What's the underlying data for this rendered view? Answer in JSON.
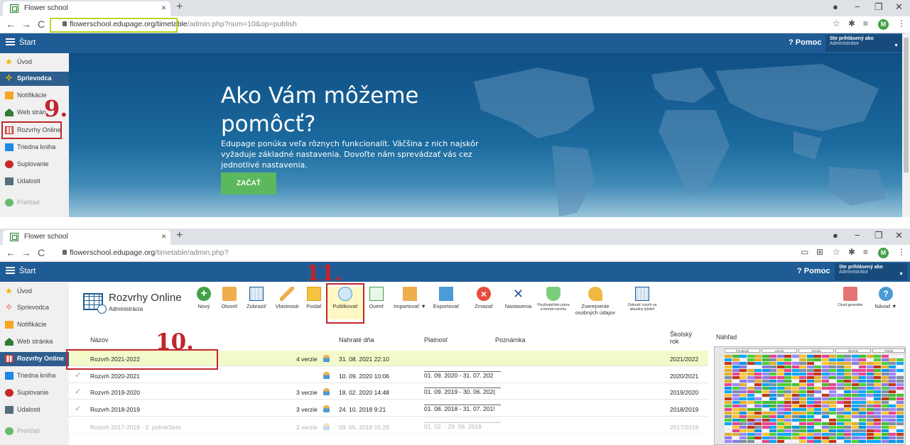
{
  "browser": {
    "tab_title": "Flower school",
    "url_top_host": "flowerschool.edupage.org/timetable",
    "url_top_path": "/admin.php?num=10&op=publish",
    "url_bottom_host": "flowerschool.edupage.org",
    "url_bottom_path": "/timetable/admin.php?",
    "profile_initial": "M"
  },
  "app": {
    "start_label": "Štart",
    "help_label": "Pomoc",
    "user_line1": "Ste prihlásený ako",
    "user_line2": "Administrátor"
  },
  "sidebar_top": [
    {
      "label": "Úvod",
      "icon": "star-icon"
    },
    {
      "label": "Sprievodca",
      "icon": "magic-wand-icon"
    },
    {
      "label": "Notifikácie",
      "icon": "mail-icon"
    },
    {
      "label": "Web strán",
      "icon": "home-icon"
    },
    {
      "label": "Rozvrhy Online",
      "icon": "timetable-icon"
    },
    {
      "label": "Triedna kniha",
      "icon": "book-icon"
    },
    {
      "label": "Suplovanie",
      "icon": "substitution-icon"
    },
    {
      "label": "Udalosti",
      "icon": "calendar-icon"
    },
    {
      "label": "Prehľad",
      "icon": "overview-icon"
    }
  ],
  "sidebar_bottom": [
    {
      "label": "Úvod",
      "icon": "star-icon"
    },
    {
      "label": "Sprievodca",
      "icon": "magic-wand-icon"
    },
    {
      "label": "Notifikácie",
      "icon": "mail-icon"
    },
    {
      "label": "Web stránka",
      "icon": "home-icon"
    },
    {
      "label": "Rozvrhy Online",
      "icon": "timetable-icon"
    },
    {
      "label": "Triedna kniha",
      "icon": "book-icon"
    },
    {
      "label": "Suplovanie",
      "icon": "substitution-icon"
    },
    {
      "label": "Udalosti",
      "icon": "calendar-icon"
    },
    {
      "label": "Prehľad",
      "icon": "overview-icon"
    }
  ],
  "hero": {
    "title": "Ako Vám môžeme pomôcť?",
    "text": "Edupage ponúka veľa rôznych funkcionalít. Väčšina z nich najskôr vyžaduje základné nastavenia. Dovoľte nám sprevádzať vás cez jednotlivé nastavenia.",
    "button": "ZAČAŤ"
  },
  "module": {
    "title": "Rozvrhy Online",
    "subtitle": "Administrácia"
  },
  "toolbar": [
    {
      "label": "Nový",
      "icon": "add-icon"
    },
    {
      "label": "Otvoriť",
      "icon": "folder-icon"
    },
    {
      "label": "Zobraziť",
      "icon": "view-table-icon"
    },
    {
      "label": "Vlastnosti",
      "icon": "pencil-icon"
    },
    {
      "label": "Poslať",
      "icon": "envelope-icon"
    },
    {
      "label": "Publikovať",
      "icon": "cloud-icon"
    },
    {
      "label": "Overiť",
      "icon": "verify-icon"
    },
    {
      "label": "Importovať",
      "icon": "import-icon"
    },
    {
      "label": "Exportovať",
      "icon": "export-icon"
    },
    {
      "label": "Zmazať",
      "icon": "delete-icon"
    },
    {
      "label": "Nastavenia",
      "icon": "tools-icon"
    },
    {
      "label": "Používateľské práva a formát rozvrhu",
      "icon": "shield-icon"
    },
    {
      "label": "Zverejnenie osobných údajov",
      "icon": "key-icon"
    },
    {
      "label": "Zobraziť rozvrh na aktuálny týždeň",
      "icon": "week-table-icon"
    }
  ],
  "toolbar_right": [
    {
      "label": "Cloud generátor",
      "icon": "pdf-icon"
    },
    {
      "label": "Návod",
      "icon": "help-icon"
    }
  ],
  "table": {
    "headers": {
      "name": "Názov",
      "uploaded": "Nahraté dňa",
      "validity": "Platnosť",
      "note": "Poznámka",
      "year": "Školský rok",
      "preview": "Náhľad"
    },
    "rows": [
      {
        "name": "Rozvrh 2021-2022",
        "versions": "4 verzie",
        "uploaded": "31. 08. 2021 22:10",
        "validity": "",
        "year": "2021/2022",
        "checked": false
      },
      {
        "name": "Rozvrh 2020-2021",
        "versions": "",
        "uploaded": "10. 09. 2020 10:06",
        "validity": "01. 09. 2020 - 31. 07. 202",
        "year": "2020/2021",
        "checked": true
      },
      {
        "name": "Rozvrh 2019-2020",
        "versions": "3 verzie",
        "uploaded": "18. 02. 2020 14:48",
        "validity": "01. 09. 2019 - 30. 06. 202(",
        "year": "2019/2020",
        "checked": true
      },
      {
        "name": "Rozvrh 2018-2019",
        "versions": "3 verzie",
        "uploaded": "24. 10. 2018 9:21",
        "validity": "01. 08. 2018 - 31. 07. 201!",
        "year": "2018/2019",
        "checked": true
      },
      {
        "name": "Rozvrh 2017-2018 - 2. polrokSem",
        "versions": "2 verzie",
        "uploaded": "09. 05. 2018 15:28",
        "validity": "01. 02. - 29. 06. 2018",
        "year": "2017/2018",
        "checked": false
      }
    ]
  },
  "preview_days": [
    "Pondelok",
    "Utorok",
    "Streda",
    "Štvrtok",
    "Piatok"
  ],
  "annotations": [
    "9.",
    "10.",
    "11."
  ],
  "colors": {
    "header_blue": "#1f5c95",
    "annotation_red": "#c0262d",
    "highlight_green": "#b8d829",
    "selected_row": "#f4f9c9"
  }
}
